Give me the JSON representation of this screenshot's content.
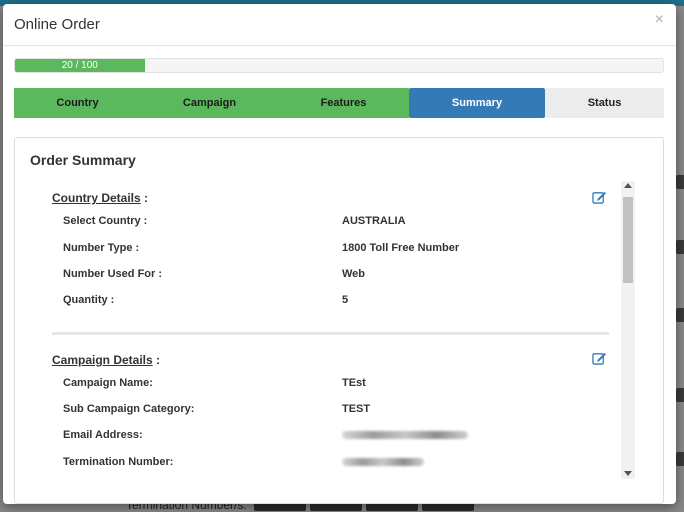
{
  "modal": {
    "title": "Online Order",
    "close_label": "×"
  },
  "progress": {
    "value": 20,
    "max": 100,
    "label": "20 / 100"
  },
  "steps": [
    {
      "label": "Country",
      "state": "done"
    },
    {
      "label": "Campaign",
      "state": "done"
    },
    {
      "label": "Features",
      "state": "done"
    },
    {
      "label": "Summary",
      "state": "active"
    },
    {
      "label": "Status",
      "state": "todo"
    }
  ],
  "summary": {
    "title": "Order Summary",
    "country_details": {
      "heading": "Country Details",
      "rows": [
        {
          "label": "Select Country :",
          "value": "AUSTRALIA"
        },
        {
          "label": "Number Type :",
          "value": "1800 Toll Free Number"
        },
        {
          "label": "Number Used For :",
          "value": "Web"
        },
        {
          "label": "Quantity :",
          "value": "5"
        }
      ]
    },
    "campaign_details": {
      "heading": "Campaign Details",
      "rows": [
        {
          "label": "Campaign Name:",
          "value": "TEst"
        },
        {
          "label": "Sub Campaign Category:",
          "value": "TEST"
        },
        {
          "label": "Email Address:",
          "value": ""
        },
        {
          "label": "Termination Number:",
          "value": ""
        }
      ]
    }
  },
  "background": {
    "footer_text": "Termination Number/s:"
  },
  "colors": {
    "step_done": "#5cb85c",
    "step_active": "#337ab7",
    "progress_fill": "#5cb85c",
    "edit_icon": "#337ab7"
  },
  "icons": {
    "close": "close-icon",
    "edit": "edit-icon",
    "scroll_up": "scroll-up-arrow-icon",
    "scroll_down": "scroll-down-arrow-icon"
  }
}
